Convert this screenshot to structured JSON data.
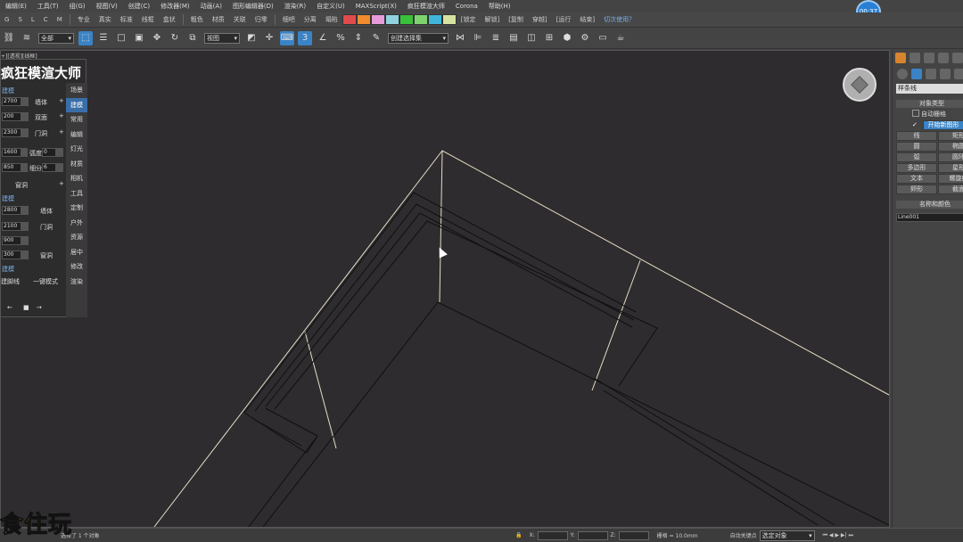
{
  "menubar": [
    "编辑(E)",
    "工具(T)",
    "组(G)",
    "视图(V)",
    "创建(C)",
    "修改器(M)",
    "动画(A)",
    "图形编辑器(D)",
    "渲染(R)",
    "自定义(U)",
    "MAXScript(X)",
    "疯狂模渲大师",
    "Corona",
    "帮助(H)"
  ],
  "tabbar": {
    "letters": [
      "G",
      "S",
      "L",
      "C",
      "M"
    ],
    "tabs": [
      "专业",
      "真实",
      "标准",
      "线框",
      "盒状",
      "粗色",
      "材质",
      "关联",
      "归零",
      "细吧",
      "分离",
      "塌陷"
    ],
    "right": [
      "[锁定",
      "解锁]",
      "[复制",
      "穿越]",
      "[运行",
      "结束]"
    ],
    "hint": "切次使用？",
    "swatch_colors": [
      "#e04b4b",
      "#f08a2e",
      "#e79bd8",
      "#90d2e0",
      "#39c13b",
      "#7ed36f",
      "#3fb6d8",
      "#d6e3a0"
    ]
  },
  "timer": "00:37",
  "toolbar": {
    "filter": "全部",
    "view": "视图",
    "named_selection": "创建选择集"
  },
  "viewport": {
    "label": "+][透视][线框]"
  },
  "plugin": {
    "title": "疯狂模渲大师",
    "sec1": "建模",
    "rows": [
      {
        "val": "2700",
        "label": "墙体"
      },
      {
        "val": "200",
        "label": "双面"
      },
      {
        "val": "2300",
        "label": "门洞"
      }
    ],
    "arc_val": "1600",
    "arc_label": "弧度",
    "arc_num": "0",
    "seg_val": "850",
    "seg_label": "细分",
    "seg_num": "6",
    "window_label": "窗洞",
    "sec2": "建模",
    "rows2": [
      {
        "val": "2800",
        "label": "墙体"
      },
      {
        "val": "2100",
        "label": "门洞"
      },
      {
        "val": "900",
        "label": ""
      },
      {
        "val": "300",
        "label": "窗洞"
      }
    ],
    "sec3": "建模",
    "btn_a": "建脚线",
    "btn_b": "一键模式",
    "nav": [
      "←",
      "■",
      "→"
    ],
    "side": [
      "场景",
      "建模",
      "常用",
      "编辑",
      "灯光",
      "材质",
      "相机",
      "工具",
      "定制",
      "户外",
      "资源",
      "居中",
      "修改",
      "渲染"
    ]
  },
  "cmdpanel": {
    "dropdown": "样条线",
    "rollout1": "对象类型",
    "autogrid": "自动栅格",
    "start_new": "开始新图形",
    "shapes": [
      "线",
      "矩形",
      "圆",
      "椭圆",
      "弧",
      "圆环",
      "多边形",
      "星形",
      "文本",
      "螺旋线",
      "卵形",
      "截面"
    ],
    "rollout2": "名称和颜色",
    "name": "Line001"
  },
  "statusbar": {
    "left": "选择了 1 个对象",
    "x_label": "X:",
    "y_label": "Y:",
    "z_label": "Z:",
    "grid": "栅格 = 10.0mm",
    "autokey": "自动关键点",
    "key_filter": "选定对象"
  },
  "watermark": "食住玩"
}
